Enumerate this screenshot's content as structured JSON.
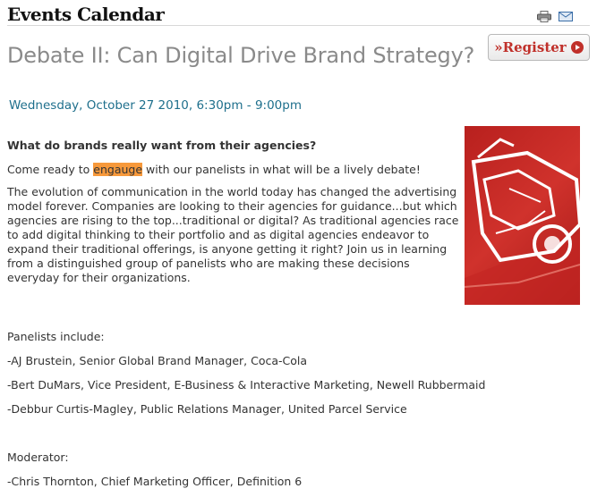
{
  "header": {
    "title": "Events Calendar",
    "icons": [
      "print-icon",
      "email-icon"
    ]
  },
  "event": {
    "title": "Debate II: Can Digital Drive Brand Strategy?",
    "date": "Wednesday, October 27 2010, 6:30pm - 9:00pm",
    "register_label": "»Register",
    "question": "What do brands really want from their agencies?",
    "intro_before": "Come ready to ",
    "intro_highlight": "engauge",
    "intro_after": " with our panelists in what will be a lively debate!",
    "description": "The evolution of communication in the world today has changed the advertising model forever.  Companies are looking to their agencies for guidance...but which agencies are rising to the top...traditional or digital?  As traditional agencies race to add digital thinking to their portfolio and as digital agencies endeavor to expand their traditional offerings, is anyone getting it right?  Join us in learning from a distinguished group of panelists who are making these decisions everyday for their organizations."
  },
  "panelists": {
    "heading": "Panelists include:",
    "items": [
      "-AJ Brustein, Senior Global Brand Manager, Coca-Cola",
      "-Bert DuMars, Vice President, E-Business & Interactive Marketing, Newell Rubbermaid",
      "-Debbur Curtis-Magley, Public Relations Manager, United Parcel Service"
    ]
  },
  "moderator": {
    "heading": "Moderator:",
    "name": "-Chris Thornton, Chief Marketing Officer, Definition 6"
  },
  "colors": {
    "accent": "#c0302a",
    "date": "#1e6f8c",
    "highlight": "#f7993b",
    "title_gray": "#8a8a8a"
  }
}
